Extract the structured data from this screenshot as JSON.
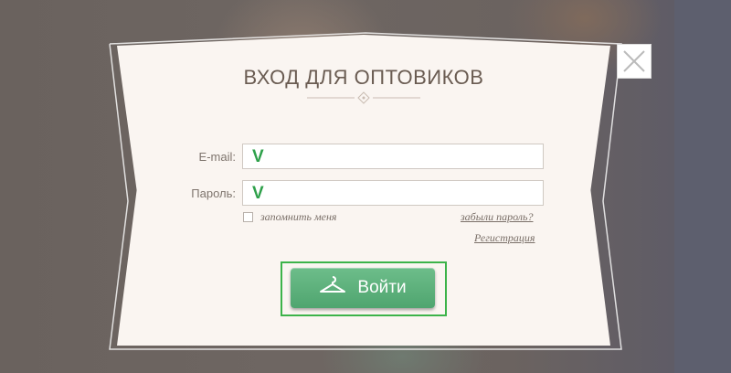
{
  "modal": {
    "title": "ВХОД ДЛЯ ОПТОВИКОВ",
    "email_label": "E-mail:",
    "email_value": "V",
    "password_label": "Пароль:",
    "password_value": "V",
    "remember_label": "запомнить меня",
    "forgot_link": "забыли пароль?",
    "register_link": "Регистрация",
    "login_button": "Войти",
    "button_icon": "hanger-icon",
    "close_icon": "close-icon"
  },
  "colors": {
    "modal_bg": "#faf5f1",
    "button_green": "#5aae79",
    "highlight_green": "#3cb34a",
    "input_check_green": "#2ea04a"
  }
}
